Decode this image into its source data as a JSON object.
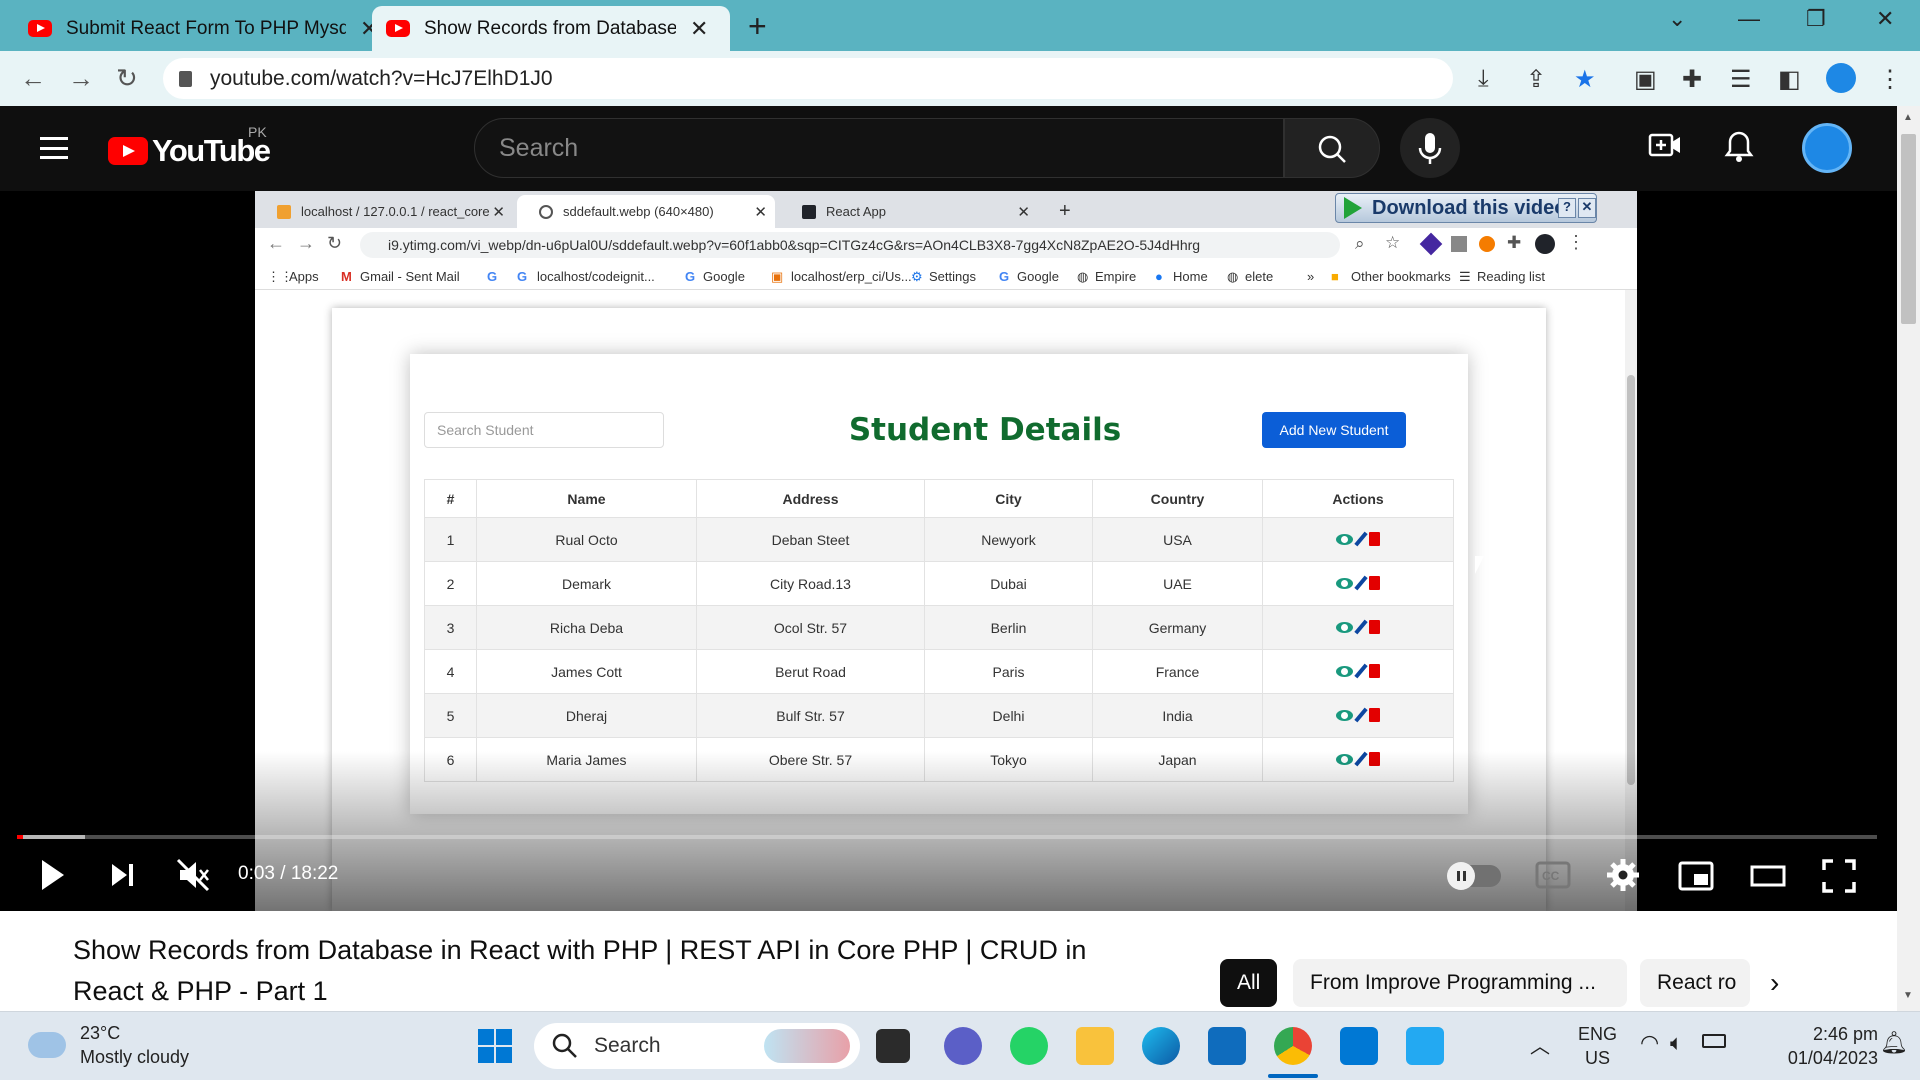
{
  "browser": {
    "tabs": [
      {
        "title": "Submit React Form To PHP Mysql"
      },
      {
        "title": "Show Records from Database in React"
      }
    ],
    "new_tab_glyph": "+",
    "url": "youtube.com/watch?v=HcJ7ElhD1J0"
  },
  "youtube": {
    "logo_text": "YouTube",
    "country": "PK",
    "search_placeholder": "Search"
  },
  "video": {
    "inner_browser": {
      "tabs": [
        {
          "title": "localhost / 127.0.0.1 / react_core"
        },
        {
          "title": "sddefault.webp (640×480)"
        },
        {
          "title": "React App"
        }
      ],
      "download_label": "Download this video",
      "url": "i9.ytimg.com/vi_webp/dn-u6pUal0U/sddefault.webp?v=60f1abb0&sqp=CITGz4cG&rs=AOn4CLB3X8-7gg4XcN8ZpAE2O-5J4dHhrg",
      "bookmarks": [
        {
          "label": "Apps"
        },
        {
          "label": "Gmail - Sent Mail"
        },
        {
          "label": ""
        },
        {
          "label": "localhost/codeignit..."
        },
        {
          "label": "Google"
        },
        {
          "label": "localhost/erp_ci/Us..."
        },
        {
          "label": "Settings"
        },
        {
          "label": "Google"
        },
        {
          "label": "Empire"
        },
        {
          "label": "Home"
        },
        {
          "label": "elete"
        },
        {
          "label": "»"
        },
        {
          "label": "Other bookmarks"
        },
        {
          "label": "Reading list"
        }
      ]
    },
    "app": {
      "search_placeholder": "Search Student",
      "title": "Student Details",
      "add_button": "Add New Student",
      "columns": [
        "#",
        "Name",
        "Address",
        "City",
        "Country",
        "Actions"
      ],
      "rows": [
        [
          "1",
          "Rual Octo",
          "Deban Steet",
          "Newyork",
          "USA"
        ],
        [
          "2",
          "Demark",
          "City Road.13",
          "Dubai",
          "UAE"
        ],
        [
          "3",
          "Richa Deba",
          "Ocol Str. 57",
          "Berlin",
          "Germany"
        ],
        [
          "4",
          "James Cott",
          "Berut Road",
          "Paris",
          "France"
        ],
        [
          "5",
          "Dheraj",
          "Bulf Str. 57",
          "Delhi",
          "India"
        ],
        [
          "6",
          "Maria James",
          "Obere Str. 57",
          "Tokyo",
          "Japan"
        ]
      ]
    },
    "time_display": "0:03 / 18:22",
    "progress_fraction": 0.003,
    "title": "Show Records from Database in React with PHP | REST API in Core PHP | CRUD in React & PHP - Part 1",
    "chips": [
      "All",
      "From Improve Programming ...",
      "React ro"
    ]
  },
  "taskbar": {
    "weather_temp": "23°C",
    "weather_desc": "Mostly cloudy",
    "search_label": "Search",
    "lang": "ENG",
    "region": "US",
    "time": "2:46 pm",
    "date": "01/04/2023"
  },
  "colors": {
    "chrome_tab_bar": "#5ab3c1",
    "youtube_red": "#ff0000",
    "app_title_green": "#106b2e",
    "add_button_blue": "#0b5ed7"
  }
}
